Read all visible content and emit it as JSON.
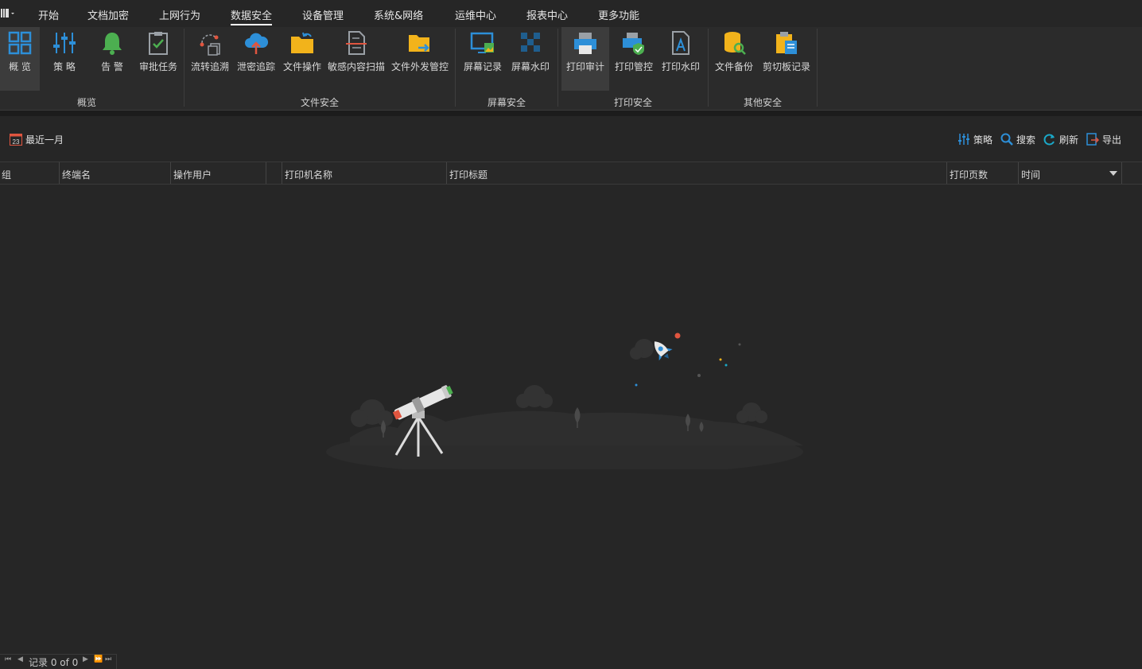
{
  "menu": {
    "items": [
      "开始",
      "文档加密",
      "上网行为",
      "数据安全",
      "设备管理",
      "系统&网络",
      "运维中心",
      "报表中心",
      "更多功能"
    ],
    "active": "数据安全"
  },
  "ribbon": {
    "groups": [
      {
        "label": "概览",
        "buttons": [
          "概 览",
          "策 略",
          "告 警",
          "审批任务"
        ]
      },
      {
        "label": "文件安全",
        "buttons": [
          "流转追溯",
          "泄密追踪",
          "文件操作",
          "敏感内容扫描",
          "文件外发管控"
        ]
      },
      {
        "label": "屏幕安全",
        "buttons": [
          "屏幕记录",
          "屏幕水印"
        ]
      },
      {
        "label": "打印安全",
        "buttons": [
          "打印审计",
          "打印管控",
          "打印水印"
        ]
      },
      {
        "label": "其他安全",
        "buttons": [
          "文件备份",
          "剪切板记录"
        ]
      }
    ],
    "selected": "打印审计"
  },
  "toolbar": {
    "date_range": "最近一月",
    "calendar_day": "23",
    "policy": "策略",
    "search": "搜索",
    "refresh": "刷新",
    "export": "导出"
  },
  "columns": [
    "组",
    "终端名",
    "操作用户",
    "打印机名称",
    "打印标题",
    "打印页数",
    "时间"
  ],
  "status": {
    "record_text": "记录 0 of 0"
  },
  "colors": {
    "accent_blue": "#2d8fd8",
    "accent_yellow": "#f2b31b",
    "accent_green": "#4caf50",
    "bg": "#262626"
  }
}
